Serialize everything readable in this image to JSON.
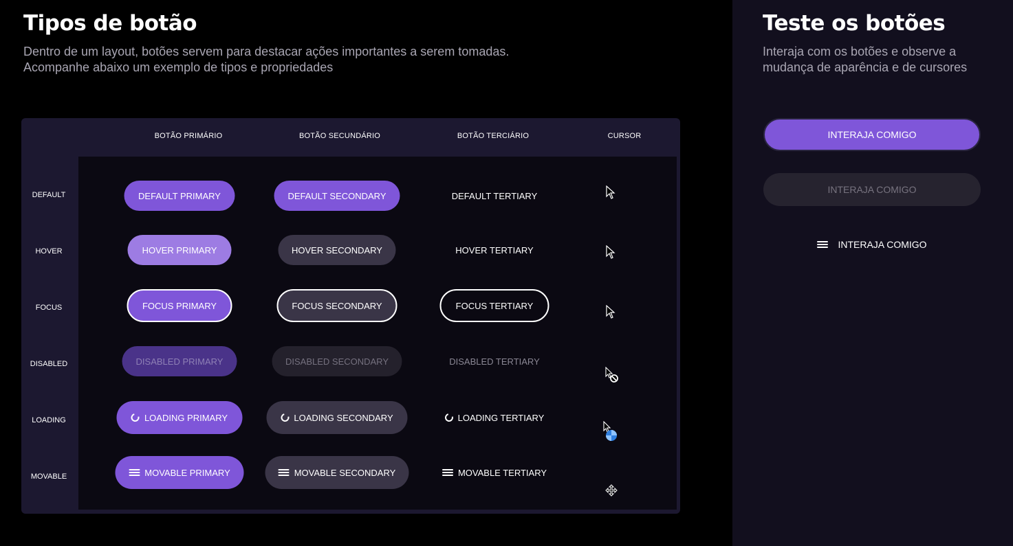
{
  "left": {
    "title": "Tipos de botão",
    "subtitle_line1": "Dentro de um layout, botões servem para destacar ações importantes a serem tomadas.",
    "subtitle_line2": "Acompanhe abaixo um exemplo de tipos e propriedades"
  },
  "right": {
    "title": "Teste os botões",
    "subtitle_line1": "Interaja com os botões e observe a",
    "subtitle_line2": "mudança de aparência e de cursores",
    "buttons": [
      {
        "label": "INTERAJA COMIGO",
        "variant": "primary"
      },
      {
        "label": "INTERAJA COMIGO",
        "variant": "disabled"
      },
      {
        "label": "INTERAJA COMIGO",
        "variant": "movable",
        "icon": "menu-icon"
      }
    ]
  },
  "table": {
    "columns": [
      "BOTÃO PRIMÁRIO",
      "BOTÃO SECUNDÁRIO",
      "BOTÃO TERCIÁRIO",
      "CURSOR"
    ],
    "rows": [
      {
        "state": "DEFAULT",
        "primary": "DEFAULT PRIMARY",
        "secondary": "DEFAULT SECONDARY",
        "tertiary": "DEFAULT TERTIARY",
        "cursor": "arrow-cursor-icon"
      },
      {
        "state": "HOVER",
        "primary": "HOVER PRIMARY",
        "secondary": "HOVER SECONDARY",
        "tertiary": "HOVER TERTIARY",
        "cursor": "arrow-cursor-icon"
      },
      {
        "state": "FOCUS",
        "primary": "FOCUS PRIMARY",
        "secondary": "FOCUS SECONDARY",
        "tertiary": "FOCUS TERTIARY",
        "cursor": "arrow-cursor-icon"
      },
      {
        "state": "DISABLED",
        "primary": "DISABLED PRIMARY",
        "secondary": "DISABLED SECONDARY",
        "tertiary": "DISABLED TERTIARY",
        "cursor": "not-allowed-cursor-icon"
      },
      {
        "state": "LOADING",
        "primary": "LOADING PRIMARY",
        "secondary": "LOADING SECONDARY",
        "tertiary": "LOADING TERTIARY",
        "cursor": "progress-cursor-icon",
        "icon": "spinner-icon"
      },
      {
        "state": "MOVABLE",
        "primary": "MOVABLE PRIMARY",
        "secondary": "MOVABLE SECONDARY",
        "tertiary": "MOVABLE TERTIARY",
        "cursor": "move-cursor-icon",
        "icon": "menu-icon"
      }
    ]
  },
  "colors": {
    "accent": "#7f56d9",
    "accent_hover": "#9d7ce3",
    "accent_disabled": "#4a3389",
    "secondary_bg": "#3a3547",
    "panel_bg": "#120f1e",
    "table_header_bg": "#1c1830",
    "table_body_bg": "#0b0912"
  }
}
